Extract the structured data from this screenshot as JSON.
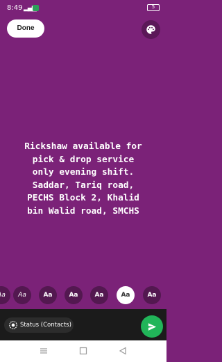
{
  "status_bar": {
    "time": "8:49",
    "battery": "5"
  },
  "top": {
    "done_label": "Done",
    "palette_icon": "palette-icon"
  },
  "status": {
    "text_lines": [
      "Rickshaw available for",
      "pick & drop service",
      "only evening shift.",
      "Saddar, Tariq road,",
      "PECHS Block 2, Khalid",
      "bin Walid road, SMCHS"
    ],
    "background_color": "#7b2278",
    "text_color": "#ffffff"
  },
  "fonts": {
    "chips": [
      "Aa",
      "Aa",
      "Aa",
      "Aa",
      "Aa",
      "Aa",
      "Aa"
    ],
    "selected_index": 5
  },
  "footer": {
    "privacy_label": "Status (Contacts)",
    "send_color": "#21b559"
  }
}
